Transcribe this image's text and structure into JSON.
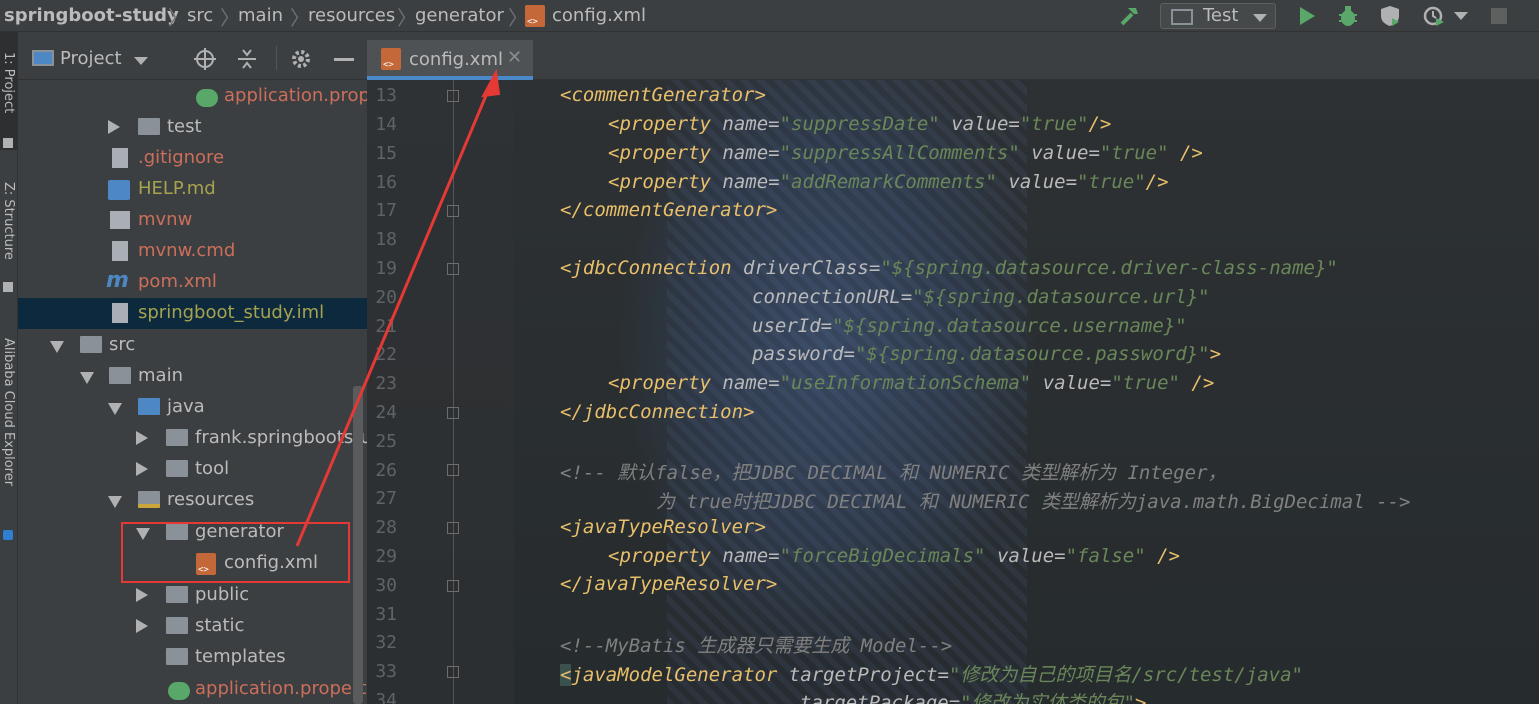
{
  "breadcrumb": {
    "items": [
      "springboot-study",
      "src",
      "main",
      "resources",
      "generator",
      "config.xml"
    ]
  },
  "toolbar": {
    "run_config": "Test"
  },
  "left_stripe": {
    "tabs": [
      "1: Project",
      "Z: Structure",
      "Alibaba Cloud Explorer"
    ]
  },
  "project_panel": {
    "title": "Project",
    "tree": [
      {
        "label": "application.prope",
        "color": "#cc6e5a"
      },
      {
        "label": "test",
        "color": "#bbbbbb"
      },
      {
        "label": ".gitignore",
        "color": "#cc6e5a"
      },
      {
        "label": "HELP.md",
        "color": "#a6a34f"
      },
      {
        "label": "mvnw",
        "color": "#cc6e5a"
      },
      {
        "label": "mvnw.cmd",
        "color": "#cc6e5a"
      },
      {
        "label": "pom.xml",
        "color": "#cc6e5a"
      },
      {
        "label": "springboot_study.iml",
        "color": "#a6a34f"
      },
      {
        "label": "src",
        "color": "#bbbbbb"
      },
      {
        "label": "main",
        "color": "#bbbbbb"
      },
      {
        "label": "java",
        "color": "#bbbbbb"
      },
      {
        "label": "frank.springbootstuc",
        "color": "#bbbbbb"
      },
      {
        "label": "tool",
        "color": "#bbbbbb"
      },
      {
        "label": "resources",
        "color": "#bbbbbb"
      },
      {
        "label": "generator",
        "color": "#bbbbbb"
      },
      {
        "label": "config.xml",
        "color": "#bbbbbb"
      },
      {
        "label": "public",
        "color": "#bbbbbb"
      },
      {
        "label": "static",
        "color": "#bbbbbb"
      },
      {
        "label": "templates",
        "color": "#bbbbbb"
      },
      {
        "label": "application.propertie",
        "color": "#cc6e5a"
      }
    ]
  },
  "editor": {
    "tab_label": "config.xml",
    "line_numbers": [
      "13",
      "14",
      "15",
      "16",
      "17",
      "18",
      "19",
      "20",
      "21",
      "22",
      "23",
      "24",
      "25",
      "26",
      "27",
      "28",
      "29",
      "30",
      "31",
      "32",
      "33",
      "34"
    ],
    "lines": {
      "l13": [
        "<commentGenerator>"
      ],
      "l14": [
        "<property",
        " name=",
        "\"suppressDate\"",
        " value=",
        "\"true\"",
        "/>"
      ],
      "l15": [
        "<property",
        " name=",
        "\"suppressAllComments\"",
        " value=",
        "\"true\"",
        " />"
      ],
      "l16": [
        "<property",
        " name=",
        "\"addRemarkComments\"",
        " value=",
        "\"true\"",
        "/>"
      ],
      "l17": [
        "</commentGenerator>"
      ],
      "l19": [
        "<jdbcConnection",
        " driverClass=",
        "\"${spring.datasource.driver-class-name}\""
      ],
      "l20": [
        "connectionURL=",
        "\"${spring.datasource.url}\""
      ],
      "l21": [
        "userId=",
        "\"${spring.datasource.username}\""
      ],
      "l22": [
        "password=",
        "\"${spring.datasource.password}\"",
        ">"
      ],
      "l23": [
        "<property",
        " name=",
        "\"useInformationSchema\"",
        " value=",
        "\"true\"",
        " />"
      ],
      "l24": [
        "</jdbcConnection>"
      ],
      "l26": "<!-- 默认false，把JDBC DECIMAL 和 NUMERIC 类型解析为 Integer，",
      "l27": "为 true时把JDBC DECIMAL 和 NUMERIC 类型解析为java.math.BigDecimal -->",
      "l28": [
        "<javaTypeResolver>"
      ],
      "l29": [
        "<property",
        " name=",
        "\"forceBigDecimals\"",
        " value=",
        "\"false\"",
        " />"
      ],
      "l30": [
        "</javaTypeResolver>"
      ],
      "l32": "<!--MyBatis 生成器只需要生成 Model-->",
      "l33": [
        "<",
        "javaModelGenerator",
        " targetProject=",
        "\"修改为自己的项目名/src/test/java\""
      ],
      "l34": [
        "targetPackage=",
        "\"修改为实体类的包\"",
        ">"
      ]
    }
  },
  "colors": {
    "tag": "#e8bf6a",
    "attr": "#bababa",
    "value": "#6a8759",
    "comment": "#808080",
    "annotation": "#e53935"
  }
}
